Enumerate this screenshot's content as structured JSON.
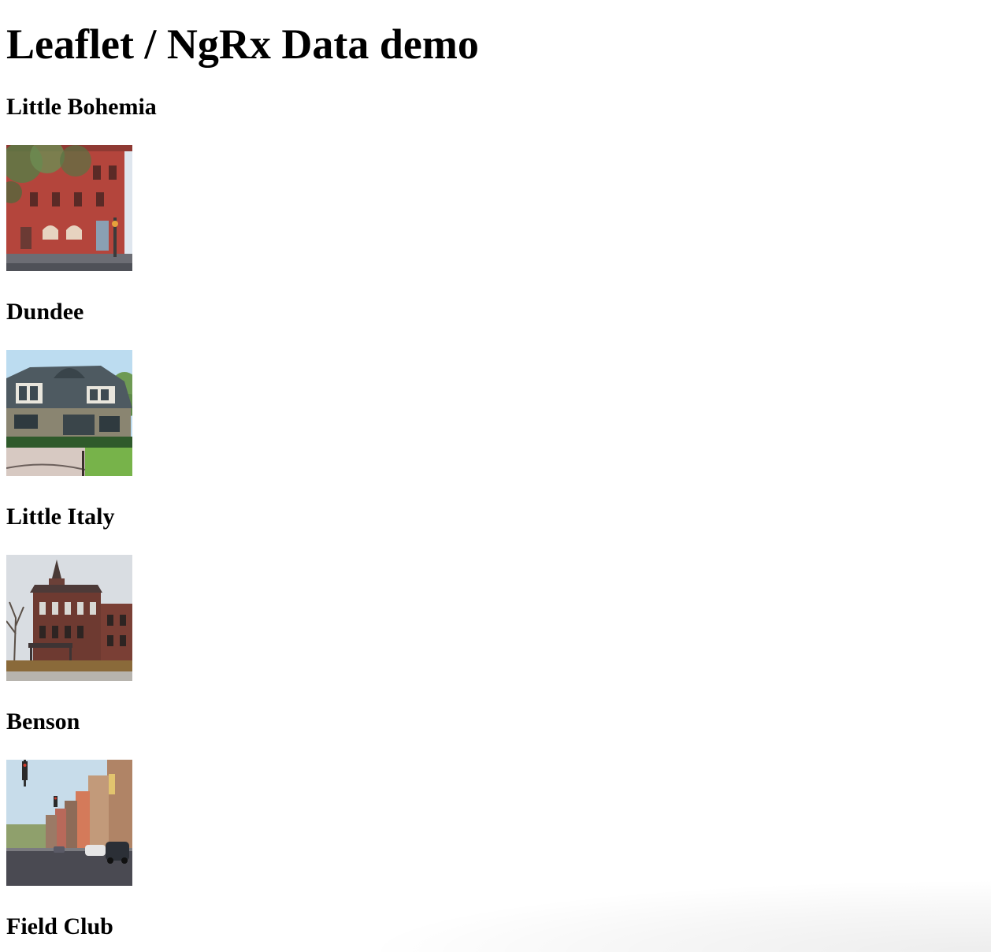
{
  "page": {
    "title": "Leaflet / NgRx Data demo"
  },
  "places": [
    {
      "name": "Little Bohemia",
      "photo_subject": "red-brick-building"
    },
    {
      "name": "Dundee",
      "photo_subject": "stone-house"
    },
    {
      "name": "Little Italy",
      "photo_subject": "victorian-mansion"
    },
    {
      "name": "Benson",
      "photo_subject": "main-street"
    },
    {
      "name": "Field Club",
      "photo_subject": ""
    }
  ]
}
